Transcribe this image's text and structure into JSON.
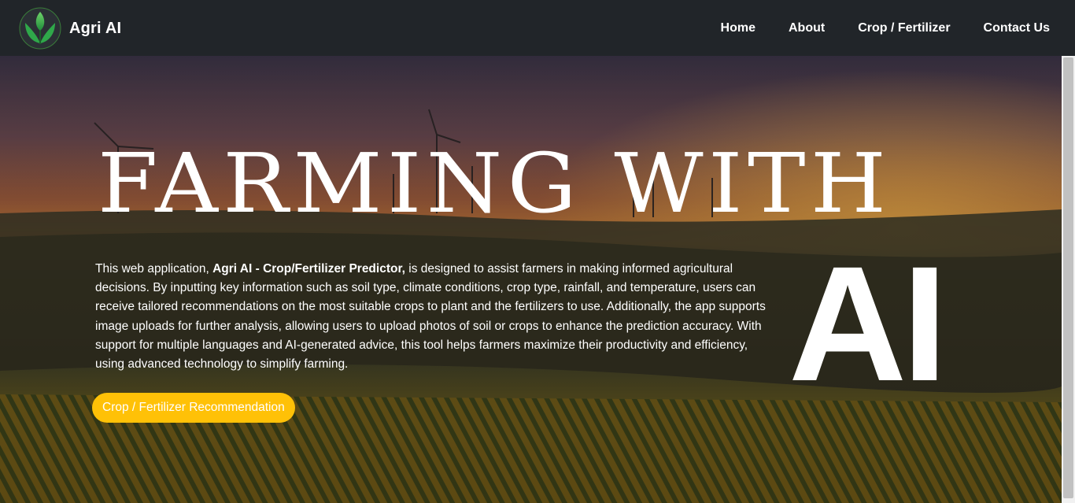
{
  "navbar": {
    "brand_name": "Agri AI",
    "logo_icon": "leaf-logo-icon",
    "links": [
      {
        "label": "Home"
      },
      {
        "label": "About"
      },
      {
        "label": "Crop / Fertilizer"
      },
      {
        "label": "Contact Us"
      }
    ]
  },
  "hero": {
    "headline_line1": "FARMING WITH",
    "headline_line2": "AI",
    "description_intro": "This web application, ",
    "description_app_name": "Agri AI - Crop/Fertilizer Predictor,",
    "description_body": " is designed to assist farmers in making informed agricultural decisions. By inputting key information such as soil type, climate conditions, crop type, rainfall, and temperature, users can receive tailored recommendations on the most suitable crops to plant and the fertilizers to use. Additionally, the app supports image uploads for further analysis, allowing users to upload photos of soil or crops to enhance the prediction accuracy. With support for multiple languages and AI-generated advice, this tool helps farmers maximize their productivity and efficiency, using advanced technology to simplify farming.",
    "cta_label": "Crop / Fertilizer Recommendation"
  },
  "colors": {
    "navbar_bg": "#212529",
    "cta_bg": "#ffc107",
    "text": "#ffffff"
  }
}
